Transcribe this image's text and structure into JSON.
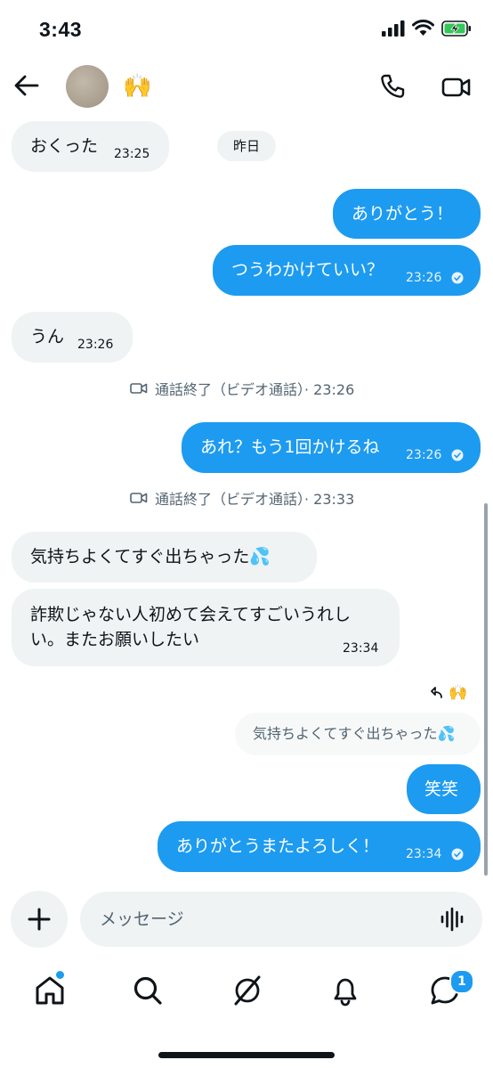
{
  "status_bar": {
    "time": "3:43"
  },
  "header": {
    "emoji": "🙌"
  },
  "messages": [
    {
      "text": "おくった",
      "time": "23:25"
    },
    {
      "text": "ありがとう！"
    },
    {
      "text": "つうわかけていい？",
      "time": "23:26"
    },
    {
      "text": "うん",
      "time": "23:26"
    },
    {
      "text": "あれ？もう1回かけるね",
      "time": "23:26"
    },
    {
      "text": "気持ちよくてすぐ出ちゃった💦"
    },
    {
      "text_line1": "詐欺じゃない人初めて会えてすごいうれし",
      "text_line2": "い。またお願いしたい",
      "time": "23:34"
    },
    {
      "text": "笑笑"
    },
    {
      "text": "ありがとうまたよろしく！",
      "time": "23:34"
    }
  ],
  "date_pill": "昨日",
  "call_events": [
    {
      "text": "通話終了（ビデオ通話）· 23:26"
    },
    {
      "text": "通話終了（ビデオ通話）· 23:33"
    }
  ],
  "reply": {
    "reaction_emoji": "🙌",
    "quoted_text": "気持ちよくてすぐ出ちゃった💦"
  },
  "composer": {
    "placeholder": "メッセージ"
  },
  "bottom_nav": {
    "messages_badge": "1"
  },
  "icons": {
    "back": "arrow-left-icon",
    "call": "phone-icon",
    "video": "video-camera-icon",
    "plus": "plus-icon",
    "voice": "voice-wave-icon",
    "home": "home-icon",
    "search": "search-icon",
    "grok": "grok-slash-icon",
    "bell": "bell-icon",
    "messages": "message-bubble-icon"
  },
  "colors": {
    "accent": "#1d9bf0",
    "incoming_bubble": "#eff3f4",
    "text": "#0f1419",
    "muted": "#536471"
  }
}
